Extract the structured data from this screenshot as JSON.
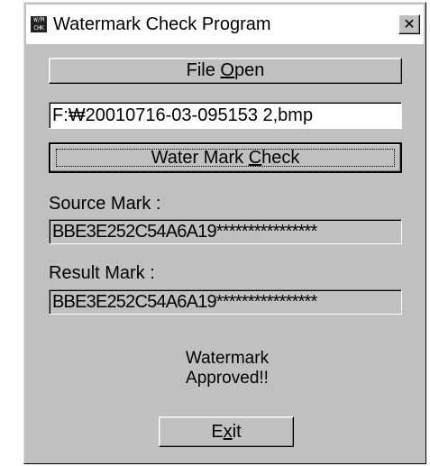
{
  "window": {
    "title": "Watermark Check Program",
    "icon_text_top": "W/M",
    "icon_text_bottom": "CHK",
    "close_glyph": "✕"
  },
  "buttons": {
    "file_open": {
      "pre": "File ",
      "mnemonic": "O",
      "post": "pen"
    },
    "check": {
      "pre": "Water Mark ",
      "mnemonic": "C",
      "post": "heck"
    },
    "exit": {
      "pre": "E",
      "mnemonic": "x",
      "post": "it"
    }
  },
  "file_path": "F:₩20010716-03-095153 2,bmp",
  "source": {
    "label": "Source Mark :",
    "value": "BBE3E252C54A6A19****************"
  },
  "result": {
    "label": "Result Mark  :",
    "value": "BBE3E252C54A6A19****************"
  },
  "status": {
    "line1": "Watermark",
    "line2": "Approved!!"
  },
  "colors": {
    "face": "#c0c0c0",
    "titlebar": "#ffffff"
  }
}
